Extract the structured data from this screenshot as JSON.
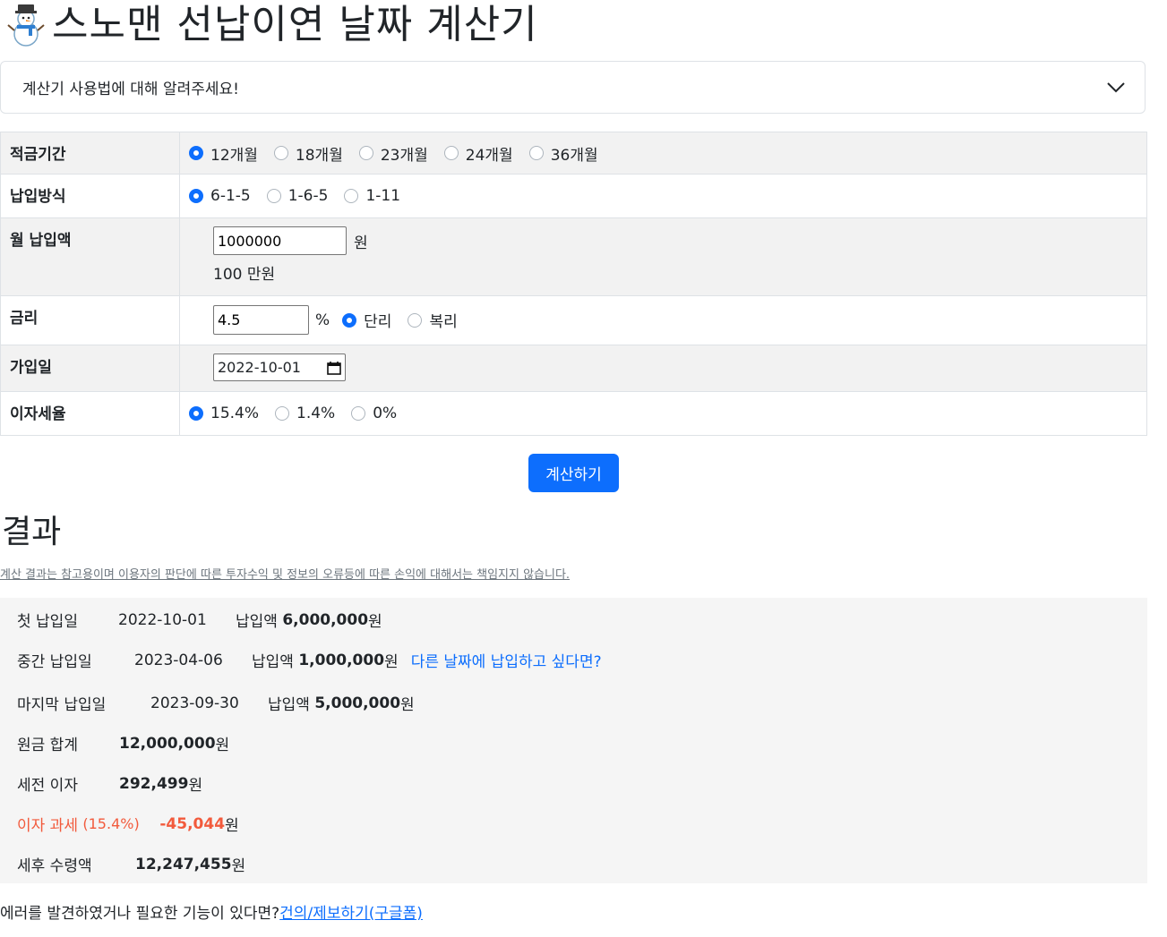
{
  "header": {
    "title": "스노맨 선납이연 날짜 계산기",
    "logo_icon": "snowman-icon"
  },
  "accordion": {
    "label": "계산기 사용법에 대해 알려주세요!",
    "icon": "chevron-down-icon"
  },
  "form": {
    "period": {
      "label": "적금기간",
      "options": [
        "12개월",
        "18개월",
        "23개월",
        "24개월",
        "36개월"
      ],
      "selected": "12개월"
    },
    "method": {
      "label": "납입방식",
      "options": [
        "6-1-5",
        "1-6-5",
        "1-11"
      ],
      "selected": "6-1-5"
    },
    "monthly": {
      "label": "월 납입액",
      "value": "1000000",
      "unit": "원",
      "helper": "100 만원"
    },
    "rate": {
      "label": "금리",
      "value": "4.5",
      "unit": "%",
      "options": [
        "단리",
        "복리"
      ],
      "selected": "단리"
    },
    "join_date": {
      "label": "가입일",
      "value": "2022-10-01"
    },
    "tax": {
      "label": "이자세율",
      "options": [
        "15.4%",
        "1.4%",
        "0%"
      ],
      "selected": "15.4%"
    }
  },
  "calc_button": "계산하기",
  "result": {
    "heading": "결과",
    "disclaimer": "계산 결과는 참고용이며 이용자의 판단에 따른 투자수익 및 정보의 오류등에 따른 손익에 대해서는 책임지지 않습니다.",
    "first": {
      "label": "첫 납입일",
      "date": "2022-10-01",
      "amount_label": "납입액",
      "amount": "6,000,000",
      "unit": "원"
    },
    "middle": {
      "label": "중간 납입일",
      "date": "2023-04-06",
      "amount_label": "납입액",
      "amount": "1,000,000",
      "unit": "원",
      "link": "다른 날짜에 납입하고 싶다면?"
    },
    "last": {
      "label": "마지막 납입일",
      "date": "2023-09-30",
      "amount_label": "납입액",
      "amount": "5,000,000",
      "unit": "원"
    },
    "principal": {
      "label": "원금 합계",
      "value": "12,000,000",
      "unit": "원"
    },
    "pretax": {
      "label": "세전 이자",
      "value": "292,499",
      "unit": "원"
    },
    "tax": {
      "label": "이자 과세",
      "rate": "(15.4%)",
      "value": "-45,044",
      "unit": "원"
    },
    "net": {
      "label": "세후 수령액",
      "value": "12,247,455",
      "unit": "원"
    }
  },
  "footer": {
    "text": "에러를 발견하였거나 필요한 기능이 있다면?",
    "link": "건의/제보하기(구글폼)"
  },
  "colors": {
    "accent": "#0d6efd",
    "negative": "#f25a3c",
    "row_alt": "#f2f2f2",
    "result_bg": "#f5f5f5"
  }
}
